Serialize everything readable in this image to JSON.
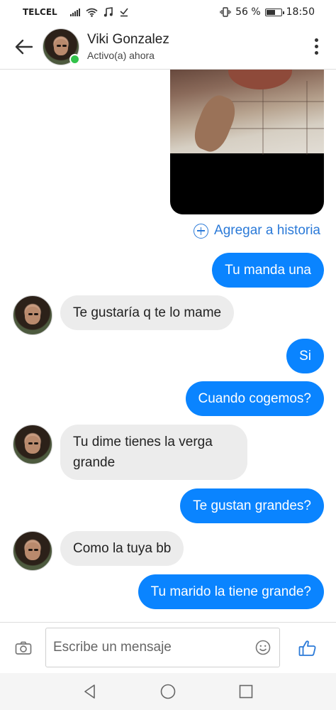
{
  "status_bar": {
    "carrier": "TELCEL",
    "battery_percent": "56 %",
    "time": "18:50",
    "battery_level": 0.56
  },
  "header": {
    "contact_name": "Viki Gonzalez",
    "presence": "Activo(a) ahora",
    "online_color": "#31c24a",
    "icons": [
      "back-arrow-icon",
      "more-vert-icon"
    ]
  },
  "chat": {
    "add_to_story": "Agregar a historia",
    "messages": [
      {
        "direction": "out",
        "text": "Tu manda una"
      },
      {
        "direction": "in",
        "text": "Te gustaría q te lo mame"
      },
      {
        "direction": "out",
        "text": "Si"
      },
      {
        "direction": "out",
        "text": "Cuando cogemos?"
      },
      {
        "direction": "in",
        "text": "Tu dime tienes la verga grande"
      },
      {
        "direction": "out",
        "text": "Te gustan grandes?"
      },
      {
        "direction": "in",
        "text": "Como la tuya bb"
      },
      {
        "direction": "out",
        "text": "Tu marido la tiene grande?"
      }
    ],
    "outgoing_color": "#0a84ff",
    "incoming_color": "#ececec"
  },
  "composer": {
    "placeholder": "Escribe un mensaje",
    "icons": [
      "camera-icon",
      "emoji-icon",
      "thumbs-up-icon"
    ],
    "accent": "#2b7ad8"
  },
  "nav_bar": {
    "icons": [
      "nav-back-icon",
      "nav-home-icon",
      "nav-recents-icon"
    ]
  }
}
